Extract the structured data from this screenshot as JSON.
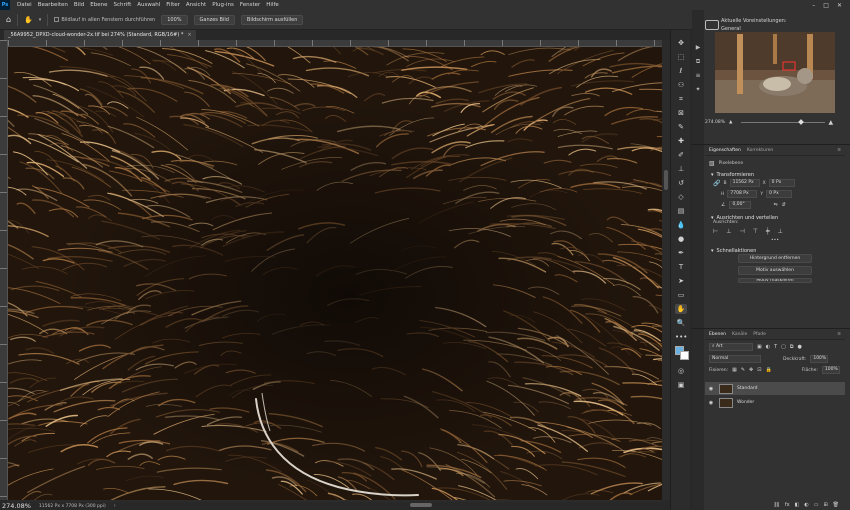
{
  "app": {
    "logo": "Ps"
  },
  "menu": [
    "Datei",
    "Bearbeiten",
    "Bild",
    "Ebene",
    "Schrift",
    "Auswahl",
    "Filter",
    "Ansicht",
    "Plug-ins",
    "Fenster",
    "Hilfe"
  ],
  "window_controls": {
    "minimize": "–",
    "maximize": "□",
    "close": "✕"
  },
  "options_bar": {
    "scroll_all_label": "Bildlauf in allen Fenstern durchführen",
    "zoom_100_label": "100%",
    "fit_label": "Ganzes Bild",
    "fill_label": "Bildschirm ausfüllen"
  },
  "document_tab": {
    "title": "_56A9952_DPXD-cloud-wonder-2x.tif bei 274% (Standard, RGB/16#) *",
    "close": "×"
  },
  "status": {
    "zoom": "274.08%",
    "info": "11562 Px x 7708 Px (300 ppi)"
  },
  "toolbar": {
    "icons": [
      "move-icon",
      "marquee-icon",
      "lasso-icon",
      "object-select-icon",
      "crop-icon",
      "frame-icon",
      "eyedropper-icon",
      "healing-brush-icon",
      "brush-icon",
      "stamp-icon",
      "history-brush-icon",
      "eraser-icon",
      "gradient-icon",
      "blur-icon",
      "dodge-icon",
      "pen-icon",
      "type-icon",
      "path-select-icon",
      "rectangle-icon",
      "hand-icon",
      "zoom-icon",
      "more-tools-icon"
    ],
    "foreground_color": "#6ab0e0",
    "background_color": "#ffffff"
  },
  "presets": {
    "title": "Aktuelle Voreinstellungen:",
    "subtitle": "General"
  },
  "navigator": {
    "zoom": "274.08%"
  },
  "properties": {
    "tabs": [
      "Eigenschaften",
      "Korrekturen"
    ],
    "layer_type": "Pixelebene",
    "transform_title": "Transformieren",
    "width_label": "B",
    "width_value": "11562 Px",
    "height_label": "H",
    "height_value": "7708 Px",
    "x_label": "X",
    "x_value": "0 Px",
    "y_label": "Y",
    "y_value": "0 Px",
    "angle_value": "0,00°",
    "align_title": "Ausrichten und verteilen",
    "align_label": "Ausrichten:",
    "more": "•••",
    "quick_actions_title": "Schnellaktionen",
    "quick_actions": [
      "Hintergrund entfernen",
      "Motiv auswählen",
      "Motiv maskieren"
    ]
  },
  "layers": {
    "tabs": [
      "Ebenen",
      "Kanäle",
      "Pfade"
    ],
    "filter_label": "Art",
    "blend_mode": "Normal",
    "opacity_label": "Deckkraft:",
    "opacity_value": "100%",
    "lock_label": "Fixieren:",
    "fill_label": "Fläche:",
    "fill_value": "100%",
    "items": [
      {
        "name": "Standard",
        "selected": true
      },
      {
        "name": "Wonder",
        "selected": false
      }
    ],
    "bottom_icons": [
      "link-icon",
      "fx-icon",
      "mask-icon",
      "adjustment-icon",
      "group-icon",
      "new-layer-icon",
      "trash-icon"
    ],
    "fx_label": "fx"
  }
}
